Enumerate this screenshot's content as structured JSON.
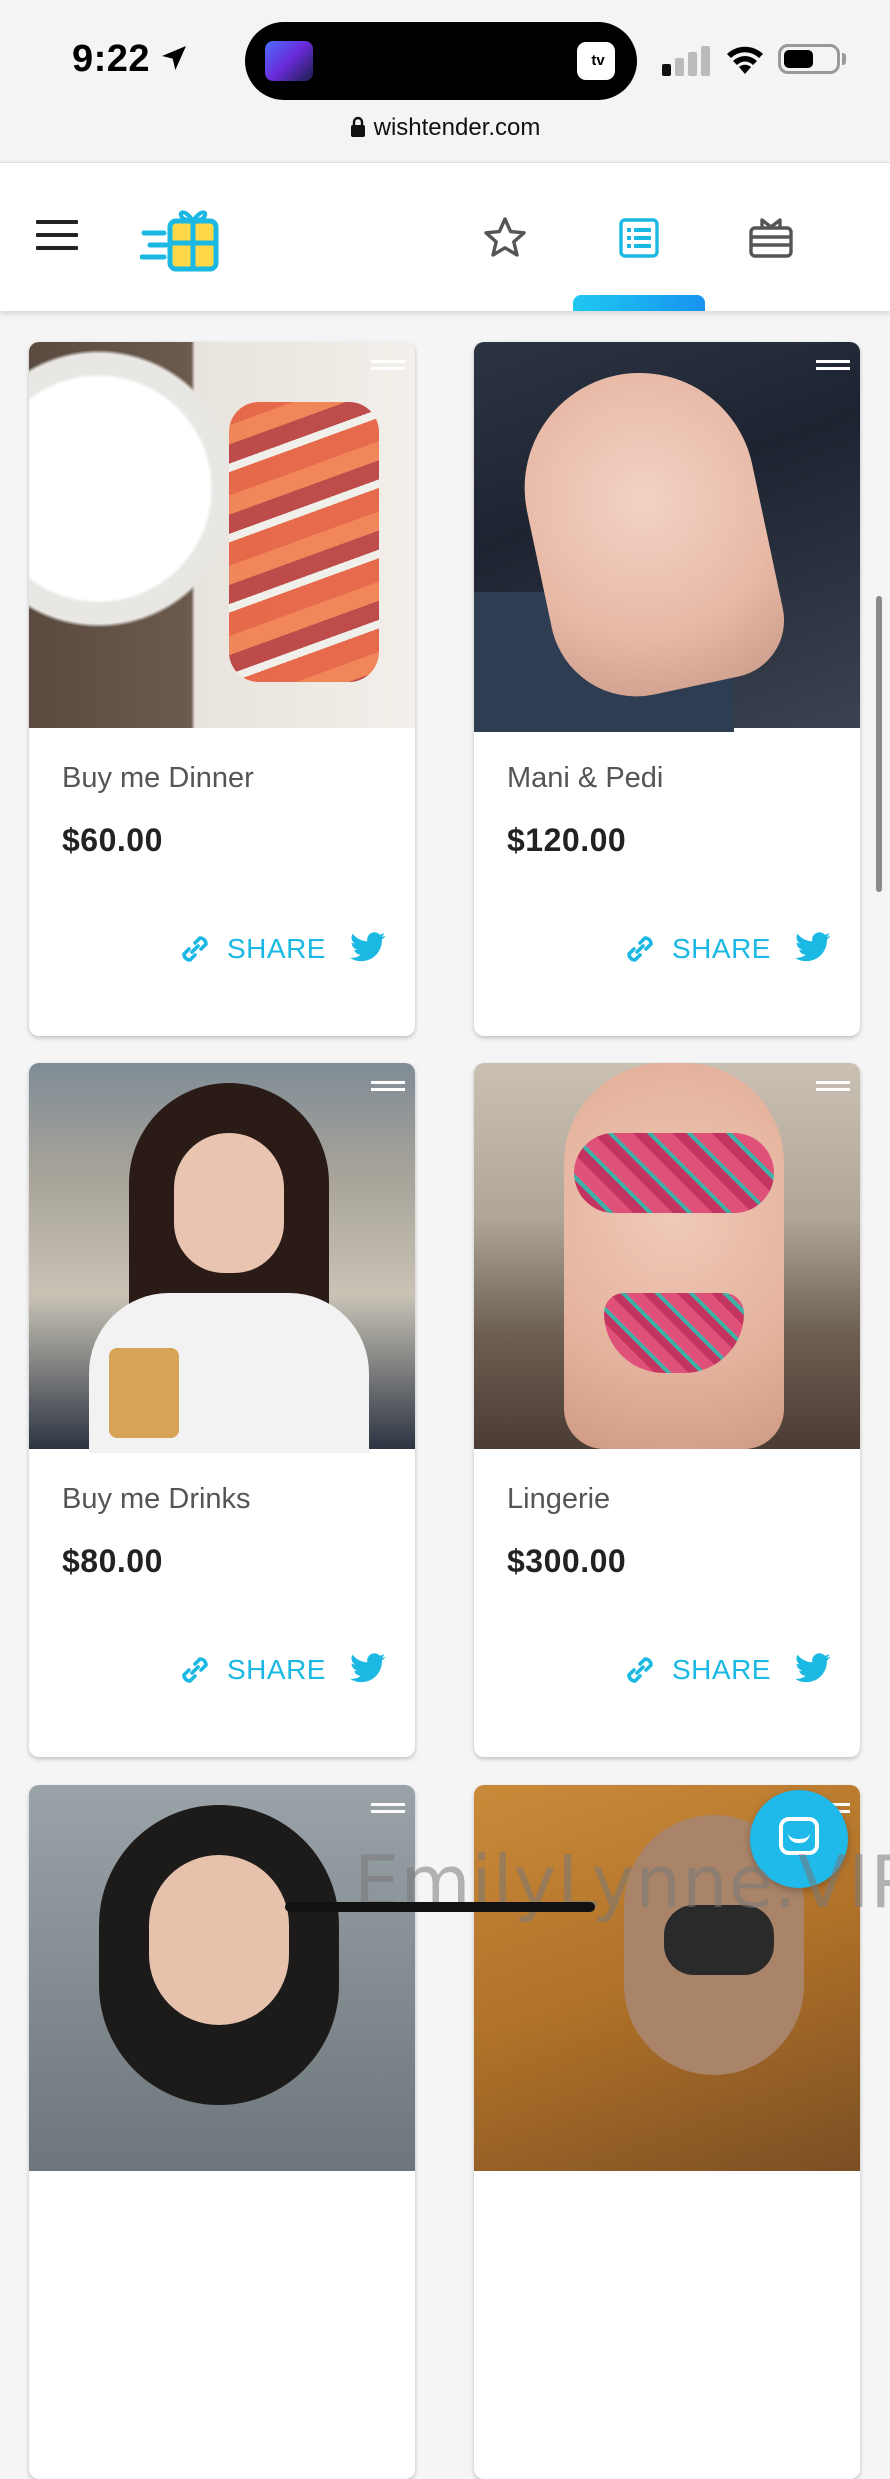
{
  "status_bar": {
    "time": "9:22",
    "tv_label": " tv"
  },
  "browser": {
    "url": "wishtender.com"
  },
  "nav": {
    "tabs": [
      {
        "icon": "star-icon"
      },
      {
        "icon": "list-icon",
        "active": true
      },
      {
        "icon": "gift-card-icon"
      }
    ],
    "accent_color": "#1ab8e2"
  },
  "wishlist": {
    "items": [
      {
        "name": "Buy me Dinner",
        "price": "$60.00",
        "share_label": "SHARE"
      },
      {
        "name": "Mani & Pedi",
        "price": "$120.00",
        "share_label": "SHARE"
      },
      {
        "name": "Buy me Drinks",
        "price": "$80.00",
        "share_label": "SHARE"
      },
      {
        "name": "Lingerie",
        "price": "$300.00",
        "share_label": "SHARE"
      },
      {
        "name": "",
        "price": "",
        "share_label": ""
      },
      {
        "name": "",
        "price": "",
        "share_label": ""
      }
    ]
  },
  "watermark": "EmilyLynne.VIP"
}
